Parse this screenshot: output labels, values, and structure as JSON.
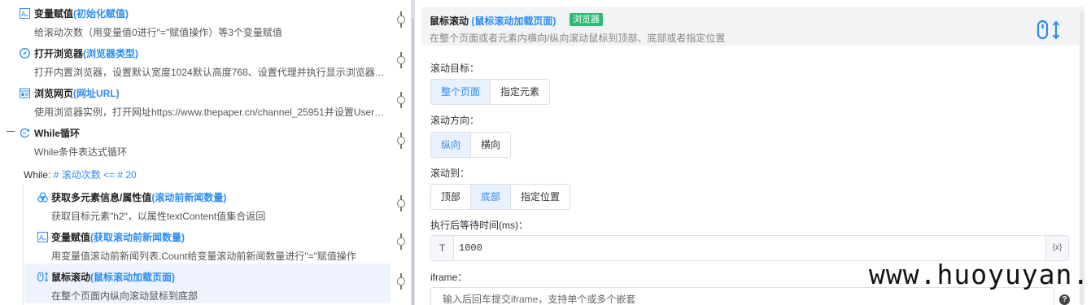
{
  "steps": [
    {
      "title": "变量赋值",
      "subtitle": "(初始化赋值)",
      "description": "给滚动次数（用变量值0进行\"=\"赋值操作）等3个变量赋值",
      "icon": "variable-assign-icon"
    },
    {
      "title": "打开浏览器",
      "subtitle": "(浏览器类型)",
      "description": "打开内置浏览器，设置默认宽度1024默认高度768、设置代理并执行显示浏览器…",
      "icon": "compass-icon"
    },
    {
      "title": "浏览网页",
      "subtitle": "(网址URL)",
      "description": "使用浏览器实例，打开网址https://www.thepaper.cn/channel_25951并设置User…",
      "icon": "webpage-icon"
    },
    {
      "title": "While循环",
      "subtitle": "",
      "description": "While条件表达式循环",
      "icon": "loop-icon"
    },
    {
      "title": "获取多元素信息/属性值",
      "subtitle": "(滚动前新闻数量)",
      "description": "获取目标元素\"h2\"，以属性textContent值集合返回",
      "icon": "elements-icon"
    },
    {
      "title": "变量赋值",
      "subtitle": "(获取滚动前新闻数量)",
      "description": "用变量值滚动前新闻列表.Count给变量滚动前新闻数量进行\"=\"赋值操作",
      "icon": "variable-assign-icon"
    },
    {
      "title": "鼠标滚动",
      "subtitle": "(鼠标滚动加载页面)",
      "description": "在整个页面内纵向滚动鼠标到底部",
      "icon": "mouse-scroll-icon"
    }
  ],
  "while_condition": {
    "prefix": "While:",
    "expression": "# 滚动次数 <= # 20"
  },
  "panel": {
    "title": "鼠标滚动",
    "subtitle": "(鼠标滚动加载页面)",
    "badge": "浏览器",
    "description": "在整个页面或者元素内横向/纵向滚动鼠标到顶部、底部或者指定位置",
    "icon": "mouse-scroll-icon"
  },
  "fields": {
    "target": {
      "label": "滚动目标：",
      "options": [
        "整个页面",
        "指定元素"
      ],
      "selected": "整个页面"
    },
    "direction": {
      "label": "滚动方向：",
      "options": [
        "纵向",
        "横向"
      ],
      "selected": "纵向"
    },
    "scroll_to": {
      "label": "滚动到：",
      "options": [
        "顶部",
        "底部",
        "指定位置"
      ],
      "selected": "底部"
    },
    "wait": {
      "label": "执行后等待时间(ms)：",
      "type_prefix": "T",
      "value": "1000",
      "var_button": "{x}"
    },
    "iframe": {
      "label": "iframe：",
      "placeholder": "输入后回车提交iframe，支持单个或多个嵌套",
      "help": "?"
    }
  },
  "watermark": "www.huoyuyan.com",
  "colors": {
    "accent": "#2d8cf0",
    "badge": "#2eb872",
    "selected_row": "#eef3fd"
  }
}
